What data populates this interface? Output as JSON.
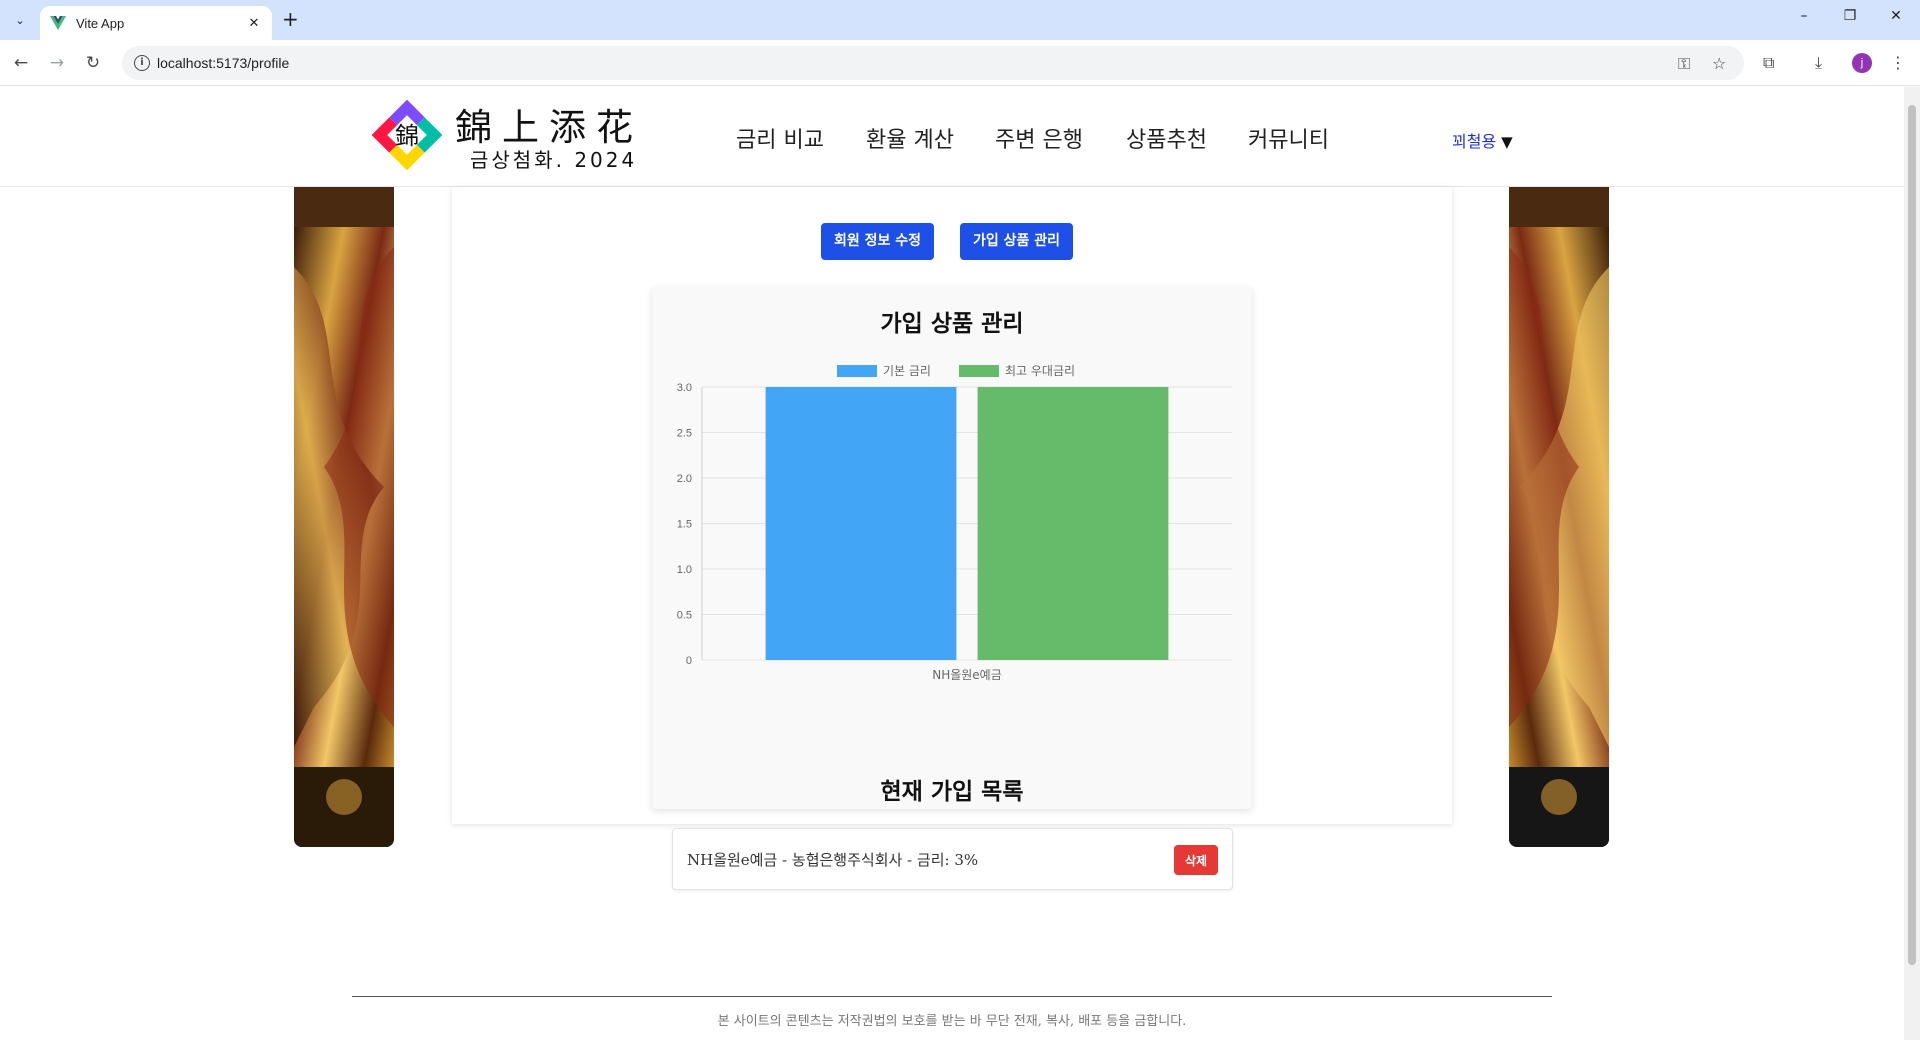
{
  "browser": {
    "tab_title": "Vite App",
    "url": "localhost:5173/profile",
    "profile_initial": "j"
  },
  "header": {
    "logo_title": "錦上添花",
    "logo_sub": "금상첨화. 2024",
    "logo_glyph": "錦",
    "nav": [
      "금리 비교",
      "환율 계산",
      "주변 은행",
      "상품추천",
      "커뮤니티"
    ],
    "user": "꾀철용",
    "user_caret": "▼"
  },
  "actions": {
    "edit_profile": "회원 정보 수정",
    "manage_products": "가입 상품 관리"
  },
  "panel": {
    "title": "가입 상품 관리",
    "list_title": "현재 가입 목록",
    "items": [
      {
        "text": "NH올원e예금 - 농협은행주식회사 - 금리: 3%",
        "delete_label": "삭제"
      }
    ]
  },
  "chart_data": {
    "type": "bar",
    "categories": [
      "NH올원e예금"
    ],
    "series": [
      {
        "name": "기본 금리",
        "values": [
          3
        ],
        "color": "#42a5f5"
      },
      {
        "name": "최고 우대금리",
        "values": [
          3
        ],
        "color": "#66bb6a"
      }
    ],
    "ylim": [
      0,
      3
    ],
    "yticks": [
      "0",
      "0.5",
      "1.0",
      "1.5",
      "2.0",
      "2.5",
      "3.0"
    ],
    "grid": true,
    "legend_position": "top"
  },
  "footer": {
    "notice": "본 사이트의 콘텐츠는 저작권법의 보호를 받는 바 무단 전재, 복사, 배포 등을 금합니다."
  }
}
